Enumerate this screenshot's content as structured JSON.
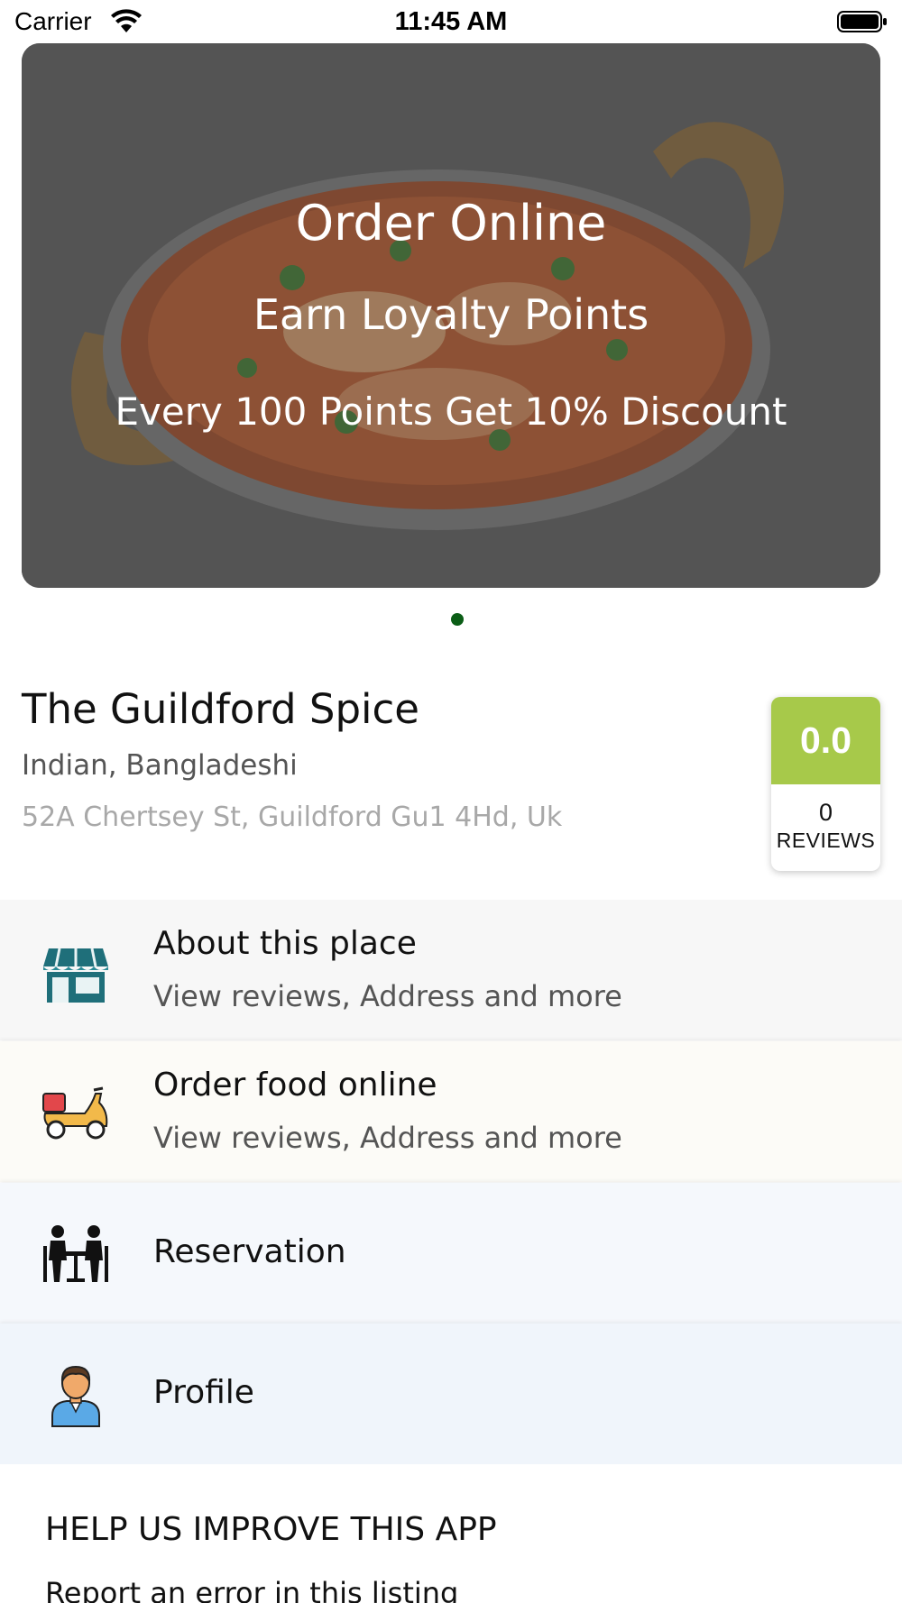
{
  "status_bar": {
    "carrier": "Carrier",
    "time": "11:45 AM"
  },
  "banner": {
    "title": "Order Online",
    "subtitle": "Earn Loyalty Points",
    "promo": "Every 100 Points Get 10% Discount",
    "pager": {
      "count": 1,
      "active_index": 0
    }
  },
  "restaurant": {
    "name": "The Guildford Spice",
    "cuisine": "Indian, Bangladeshi",
    "address": "52A Chertsey St, Guildford Gu1 4Hd, Uk",
    "rating": {
      "score": "0.0",
      "review_count": "0",
      "reviews_label": "REVIEWS"
    }
  },
  "menu": {
    "about": {
      "title": "About this place",
      "subtitle": "View reviews, Address and more",
      "icon": "storefront-icon"
    },
    "order": {
      "title": "Order food online",
      "subtitle": "View reviews, Address and more",
      "icon": "delivery-scooter-icon"
    },
    "reservation": {
      "title": "Reservation",
      "icon": "dining-table-icon"
    },
    "profile": {
      "title": "Profile",
      "icon": "user-avatar-icon"
    }
  },
  "help": {
    "title": "HELP US IMPROVE THIS APP",
    "link": "Report an error in this listing"
  },
  "colors": {
    "rating_green": "#a7c94a",
    "pager_active": "#0b5d16"
  }
}
